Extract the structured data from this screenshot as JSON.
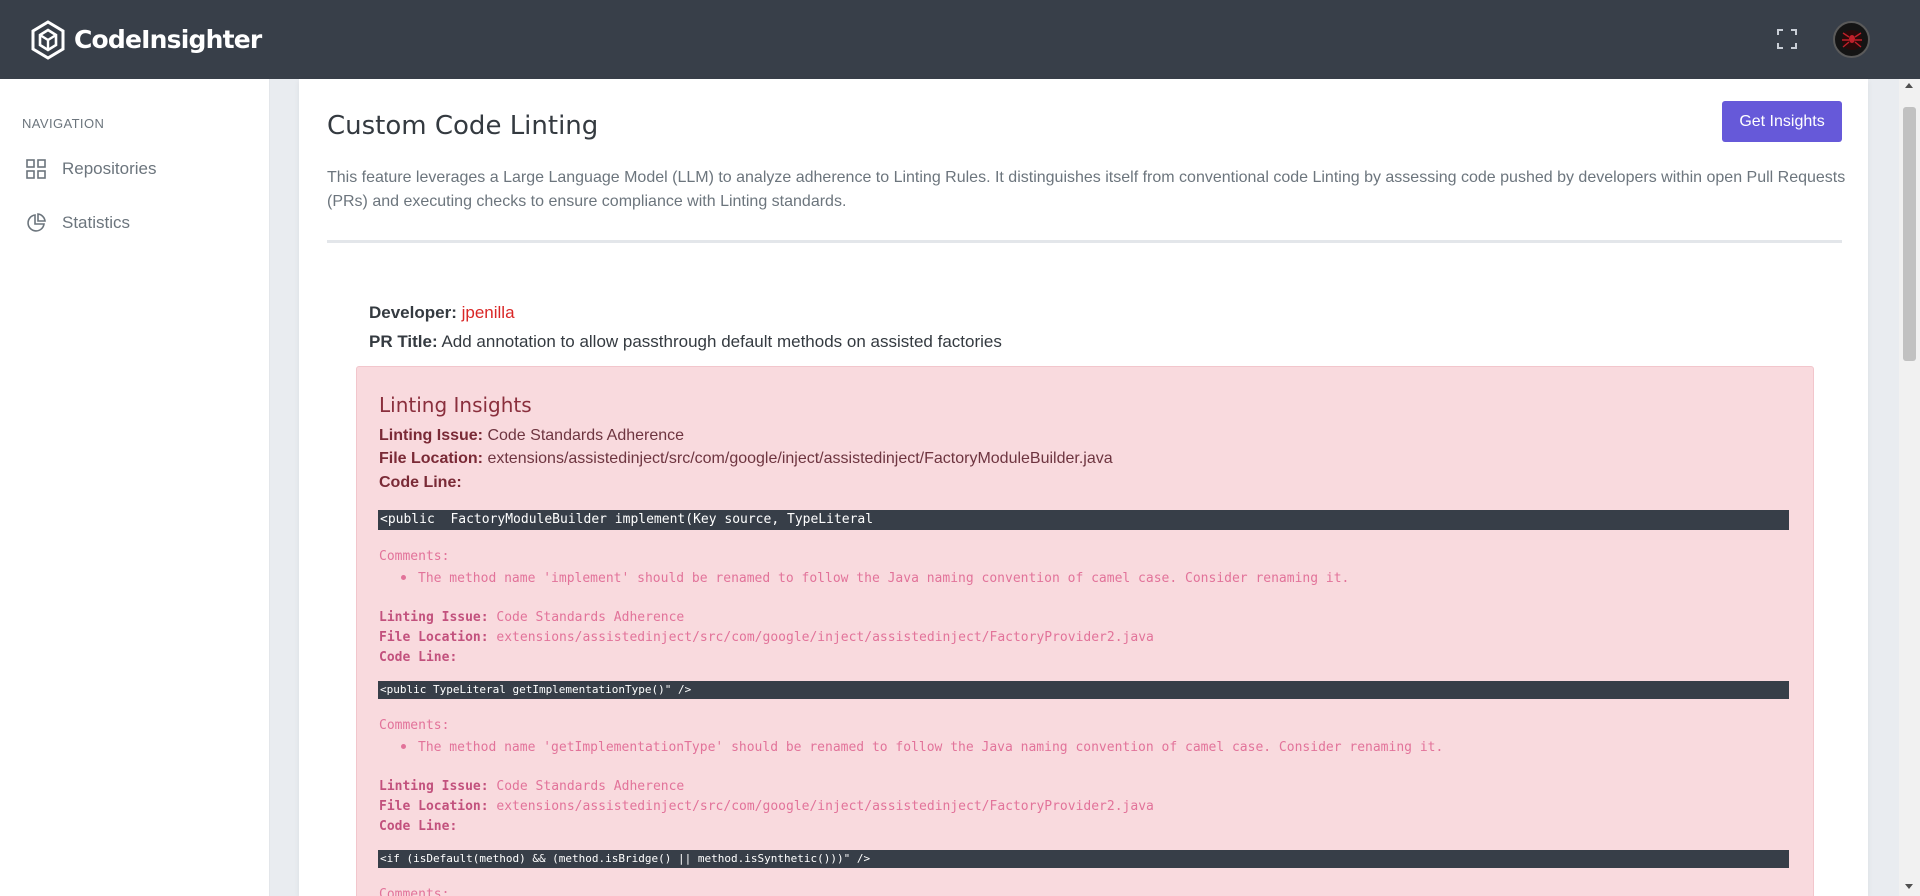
{
  "app": {
    "brand_name": "CodeInsighter",
    "avatar_icon": "spider-avatar-icon",
    "fullscreen_icon": "fullscreen-icon"
  },
  "sidebar": {
    "heading": "NAVIGATION",
    "items": [
      {
        "label": "Repositories",
        "icon": "grid-icon"
      },
      {
        "label": "Statistics",
        "icon": "pie-chart-icon"
      }
    ]
  },
  "page": {
    "title": "Custom Code Linting",
    "get_insights_label": "Get Insights",
    "description": "This feature leverages a Large Language Model (LLM) to analyze adherence to Linting Rules. It distinguishes itself from conventional code Linting by assessing code pushed by developers within open Pull Requests (PRs) and executing checks to ensure compliance with Linting standards."
  },
  "pr": {
    "developer_label": "Developer:",
    "developer": "jpenilla",
    "title_label": "PR Title:",
    "title": "Add annotation to allow passthrough default methods on assisted factories"
  },
  "insights": {
    "title": "Linting Insights",
    "labels": {
      "issue": "Linting Issue:",
      "location": "File Location:",
      "code_line": "Code Line:",
      "comments": "Comments:"
    },
    "items": [
      {
        "issue": "Code Standards Adherence",
        "location": "extensions/assistedinject/src/com/google/inject/assistedinject/FactoryModuleBuilder.java",
        "code": "<public  FactoryModuleBuilder implement(Key source, TypeLiteral",
        "comment": "The method name 'implement' should be renamed to follow the Java naming convention of camel case. Consider renaming it."
      },
      {
        "issue": "Code Standards Adherence",
        "location": "extensions/assistedinject/src/com/google/inject/assistedinject/FactoryProvider2.java",
        "code": "<public TypeLiteral getImplementationType()\" />",
        "comment": "The method name 'getImplementationType' should be renamed to follow the Java naming convention of camel case. Consider renaming it."
      },
      {
        "issue": "Code Standards Adherence",
        "location": "extensions/assistedinject/src/com/google/inject/assistedinject/FactoryProvider2.java",
        "code": "<if (isDefault(method) && (method.isBridge() || method.isSynthetic()))\" />",
        "comment": ""
      }
    ]
  },
  "colors": {
    "topbar": "#383f49",
    "accent": "#6659d9",
    "alert_bg": "#f9dade",
    "developer": "#d92626",
    "code_bg": "#373e48"
  }
}
